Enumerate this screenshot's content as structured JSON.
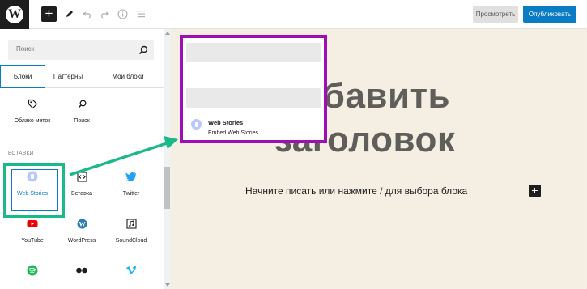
{
  "toolbar": {
    "preview_label": "Просмотреть",
    "publish_label": "Опубликовать"
  },
  "sidebar": {
    "search_placeholder": "Поиск",
    "tabs": [
      {
        "label": "Блоки",
        "active": true
      },
      {
        "label": "Паттерны",
        "active": false
      },
      {
        "label": "Мои блоки",
        "active": false
      }
    ],
    "top_blocks": [
      {
        "label": "Облако меток",
        "icon": "tag-icon"
      },
      {
        "label": "Поиск",
        "icon": "search-icon"
      }
    ],
    "section_title": "ВСТАВКИ",
    "embeds": [
      {
        "label": "Web Stories",
        "icon": "web-stories-icon",
        "selected": true
      },
      {
        "label": "Вставка",
        "icon": "embed-code-icon"
      },
      {
        "label": "Twitter",
        "icon": "twitter-icon"
      },
      {
        "label": "YouTube",
        "icon": "youtube-icon"
      },
      {
        "label": "WordPress",
        "icon": "wordpress-icon"
      },
      {
        "label": "SoundCloud",
        "icon": "soundcloud-icon"
      },
      {
        "label": "",
        "icon": "spotify-icon"
      },
      {
        "label": "",
        "icon": "flickr-icon"
      },
      {
        "label": "",
        "icon": "vimeo-icon"
      }
    ]
  },
  "preview": {
    "title": "Web Stories",
    "description": "Embed Web Stories."
  },
  "canvas": {
    "heading": "Добавить заголовок",
    "paragraph": "Начните писать или нажмите / для выбора блока"
  },
  "colors": {
    "highlight_green": "#1bb98a",
    "popup_purple": "#a10db5",
    "accent_blue": "#0a7cc4",
    "canvas_bg": "#f4efe2"
  }
}
